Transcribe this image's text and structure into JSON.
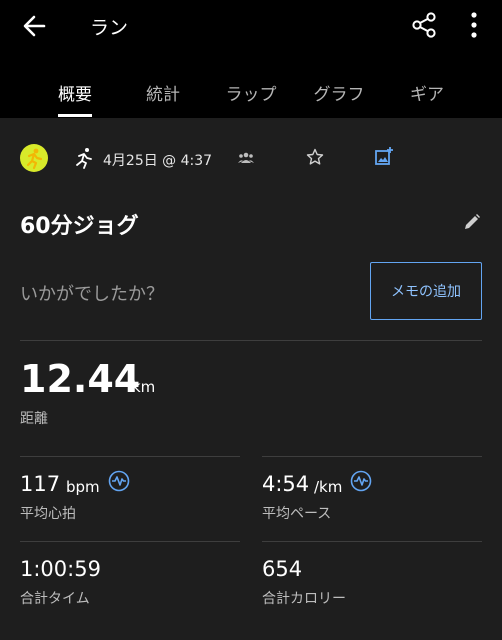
{
  "header": {
    "title": "ラン"
  },
  "tabs": [
    "概要",
    "統計",
    "ラップ",
    "グラフ",
    "ギア"
  ],
  "info": {
    "date": "4月25日 @ 4:37"
  },
  "activity": {
    "name": "60分ジョグ"
  },
  "feeling": {
    "prompt": "いかがでしたか？",
    "memo_button": "メモの追加"
  },
  "distance": {
    "value": "12.44",
    "unit": "km",
    "label": "距離"
  },
  "stats": {
    "heart_rate": {
      "value": "117",
      "unit": "bpm",
      "label": "平均心拍"
    },
    "pace": {
      "value": "4:54",
      "unit": "/km",
      "label": "平均ペース"
    },
    "time": {
      "value": "1:00:59",
      "label": "合計タイム"
    },
    "calories": {
      "value": "654",
      "label": "合計カロリー"
    }
  },
  "colors": {
    "accent": "#63a5f2",
    "badge": "#d8ea2a",
    "background": "#1e1e1e",
    "header": "#000000"
  },
  "icons": [
    "back-arrow-icon",
    "share-icon",
    "more-vert-icon",
    "run-badge-icon",
    "running-icon",
    "people-icon",
    "star-icon",
    "add-photo-icon",
    "pencil-icon",
    "heart-rate-icon",
    "pace-icon"
  ]
}
